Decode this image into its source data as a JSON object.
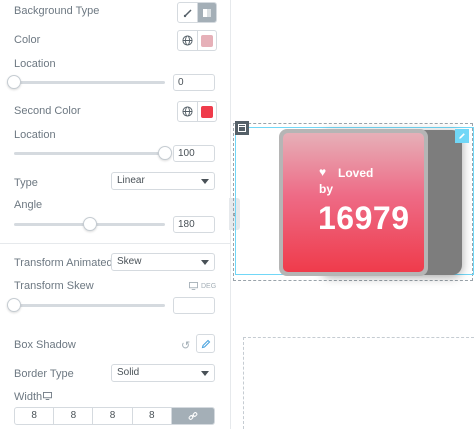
{
  "panel": {
    "background_type": {
      "label": "Background Type"
    },
    "color": {
      "label": "Color",
      "value": "#e6b0b8"
    },
    "location1": {
      "label": "Location",
      "value": "0",
      "fraction": 0.0
    },
    "second_color": {
      "label": "Second Color",
      "value": "#ef3b4b"
    },
    "location2": {
      "label": "Location",
      "value": "100",
      "fraction": 1.0
    },
    "type": {
      "label": "Type",
      "value": "Linear"
    },
    "angle": {
      "label": "Angle",
      "value": "180",
      "fraction": 0.5
    },
    "transform_animated": {
      "label": "Transform Animated",
      "value": "Skew"
    },
    "transform_skew": {
      "label": "Transform Skew",
      "unit": "DEG",
      "value": "",
      "fraction": 0.0
    },
    "box_shadow": {
      "label": "Box Shadow"
    },
    "border_type": {
      "label": "Border Type",
      "value": "Solid"
    },
    "width": {
      "label": "Width",
      "values": [
        "8",
        "8",
        "8",
        "8"
      ]
    }
  },
  "card": {
    "heart": "♥",
    "line1": "Loved",
    "line2": "by",
    "count": "16979",
    "colors": {
      "top": "#e6b0b8",
      "bottom": "#ef3b4b",
      "frame": "#b5b5b5",
      "shadow": "#7d7d7d"
    }
  },
  "accent": "#71d7f7"
}
